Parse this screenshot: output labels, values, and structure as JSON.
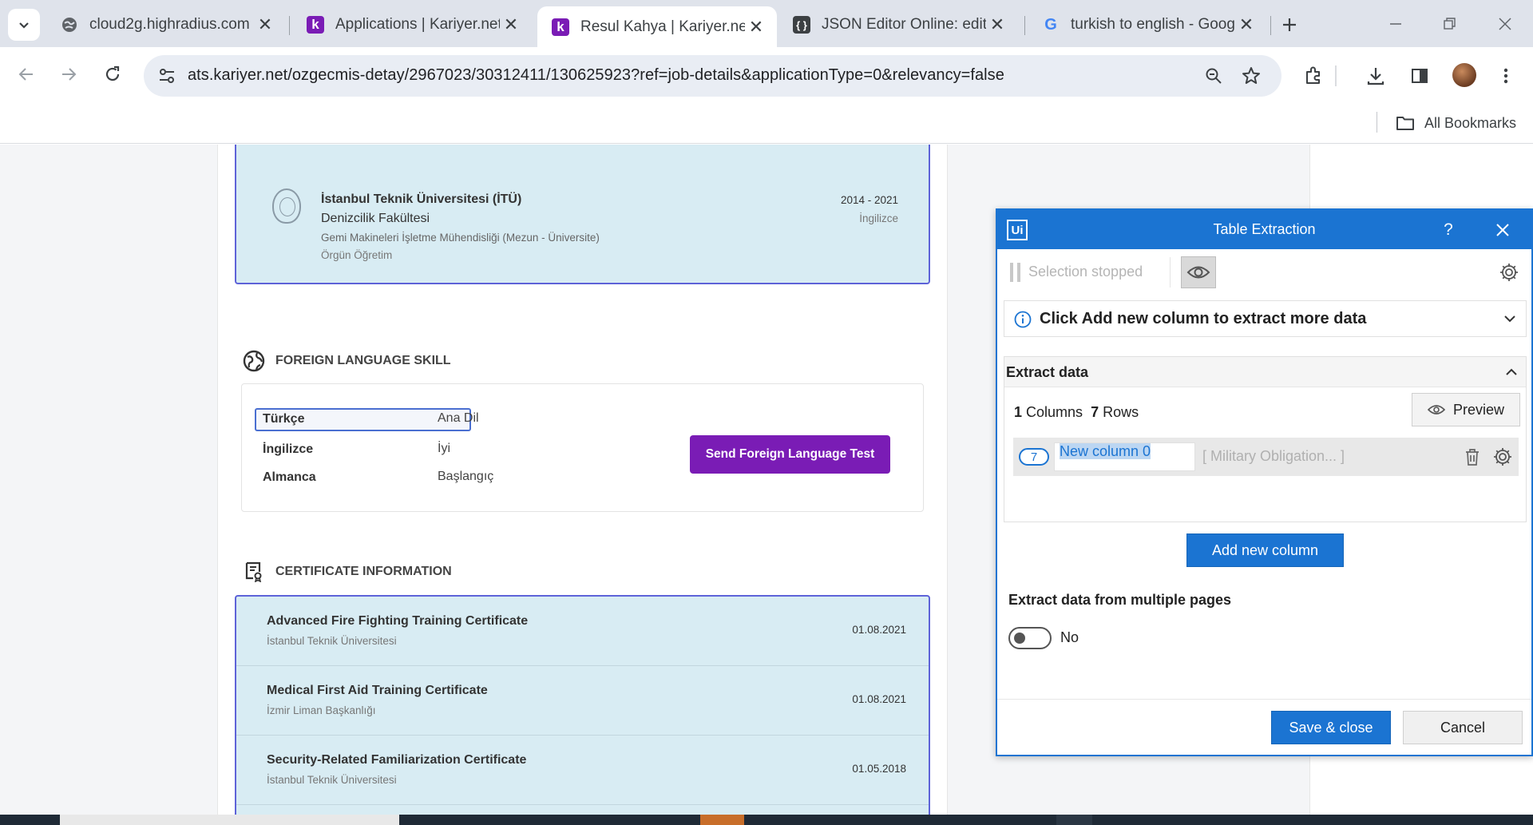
{
  "browser": {
    "tabs": [
      {
        "title": "cloud2g.highradius.com",
        "favicon": "globe-icon"
      },
      {
        "title": "Applications | Kariyer.net",
        "favicon": "k"
      },
      {
        "title": "Resul Kahya | Kariyer.net",
        "favicon": "k",
        "active": true
      },
      {
        "title": "JSON Editor Online: edit",
        "favicon": "{ }"
      },
      {
        "title": "turkish to english - Goog",
        "favicon": "G"
      }
    ],
    "url": "ats.kariyer.net/ozgecmis-detay/2967023/30312411/130625923?ref=job-details&applicationType=0&relevancy=false",
    "bookmarks_label": "All Bookmarks"
  },
  "education": {
    "school": "İstanbul Teknik Üniversitesi (İTÜ)",
    "faculty": "Denizcilik Fakültesi",
    "department": "Gemi Makineleri İşletme Mühendisliği (Mezun - Üniversite)",
    "type": "Örgün Öğretim",
    "years": "2014 - 2021",
    "language": "İngilizce"
  },
  "foreign_language": {
    "heading": "FOREIGN LANGUAGE SKILL",
    "rows": [
      {
        "language": "Türkçe",
        "level": "Ana Dil"
      },
      {
        "language": "İngilizce",
        "level": "İyi"
      },
      {
        "language": "Almanca",
        "level": "Başlangıç"
      }
    ],
    "send_test_label": "Send Foreign Language Test"
  },
  "certificates": {
    "heading": "CERTIFICATE INFORMATION",
    "items": [
      {
        "name": "Advanced Fire Fighting Training Certificate",
        "issuer": "İstanbul Teknik Üniversitesi",
        "date": "01.08.2021"
      },
      {
        "name": "Medical First Aid Training Certificate",
        "issuer": "İzmir Liman Başkanlığı",
        "date": "01.08.2021"
      },
      {
        "name": "Security-Related Familiarization Certificate",
        "issuer": "İstanbul Teknik Üniversitesi",
        "date": "01.05.2018"
      }
    ]
  },
  "dialog": {
    "logo": "Ui",
    "title": "Table Extraction",
    "help": "?",
    "selection_status": "Selection stopped",
    "info_text": "Click Add new column to extract more data",
    "extract_title": "Extract data",
    "columns_count": "1",
    "columns_label": "Columns",
    "rows_count": "7",
    "rows_label": "Rows",
    "preview_label": "Preview",
    "column": {
      "badge": "7",
      "name": "New column 0",
      "sample": "[ Military Obligation...  ]"
    },
    "add_column_label": "Add new column",
    "multi_pages_label": "Extract data from multiple pages",
    "multi_pages_value": "No",
    "save_label": "Save & close",
    "cancel_label": "Cancel"
  },
  "colors": {
    "accent_purple": "#7a1cb5",
    "dialog_blue": "#1b74d2",
    "card_bg": "#d8ecf3",
    "card_border": "#5e63d8"
  }
}
